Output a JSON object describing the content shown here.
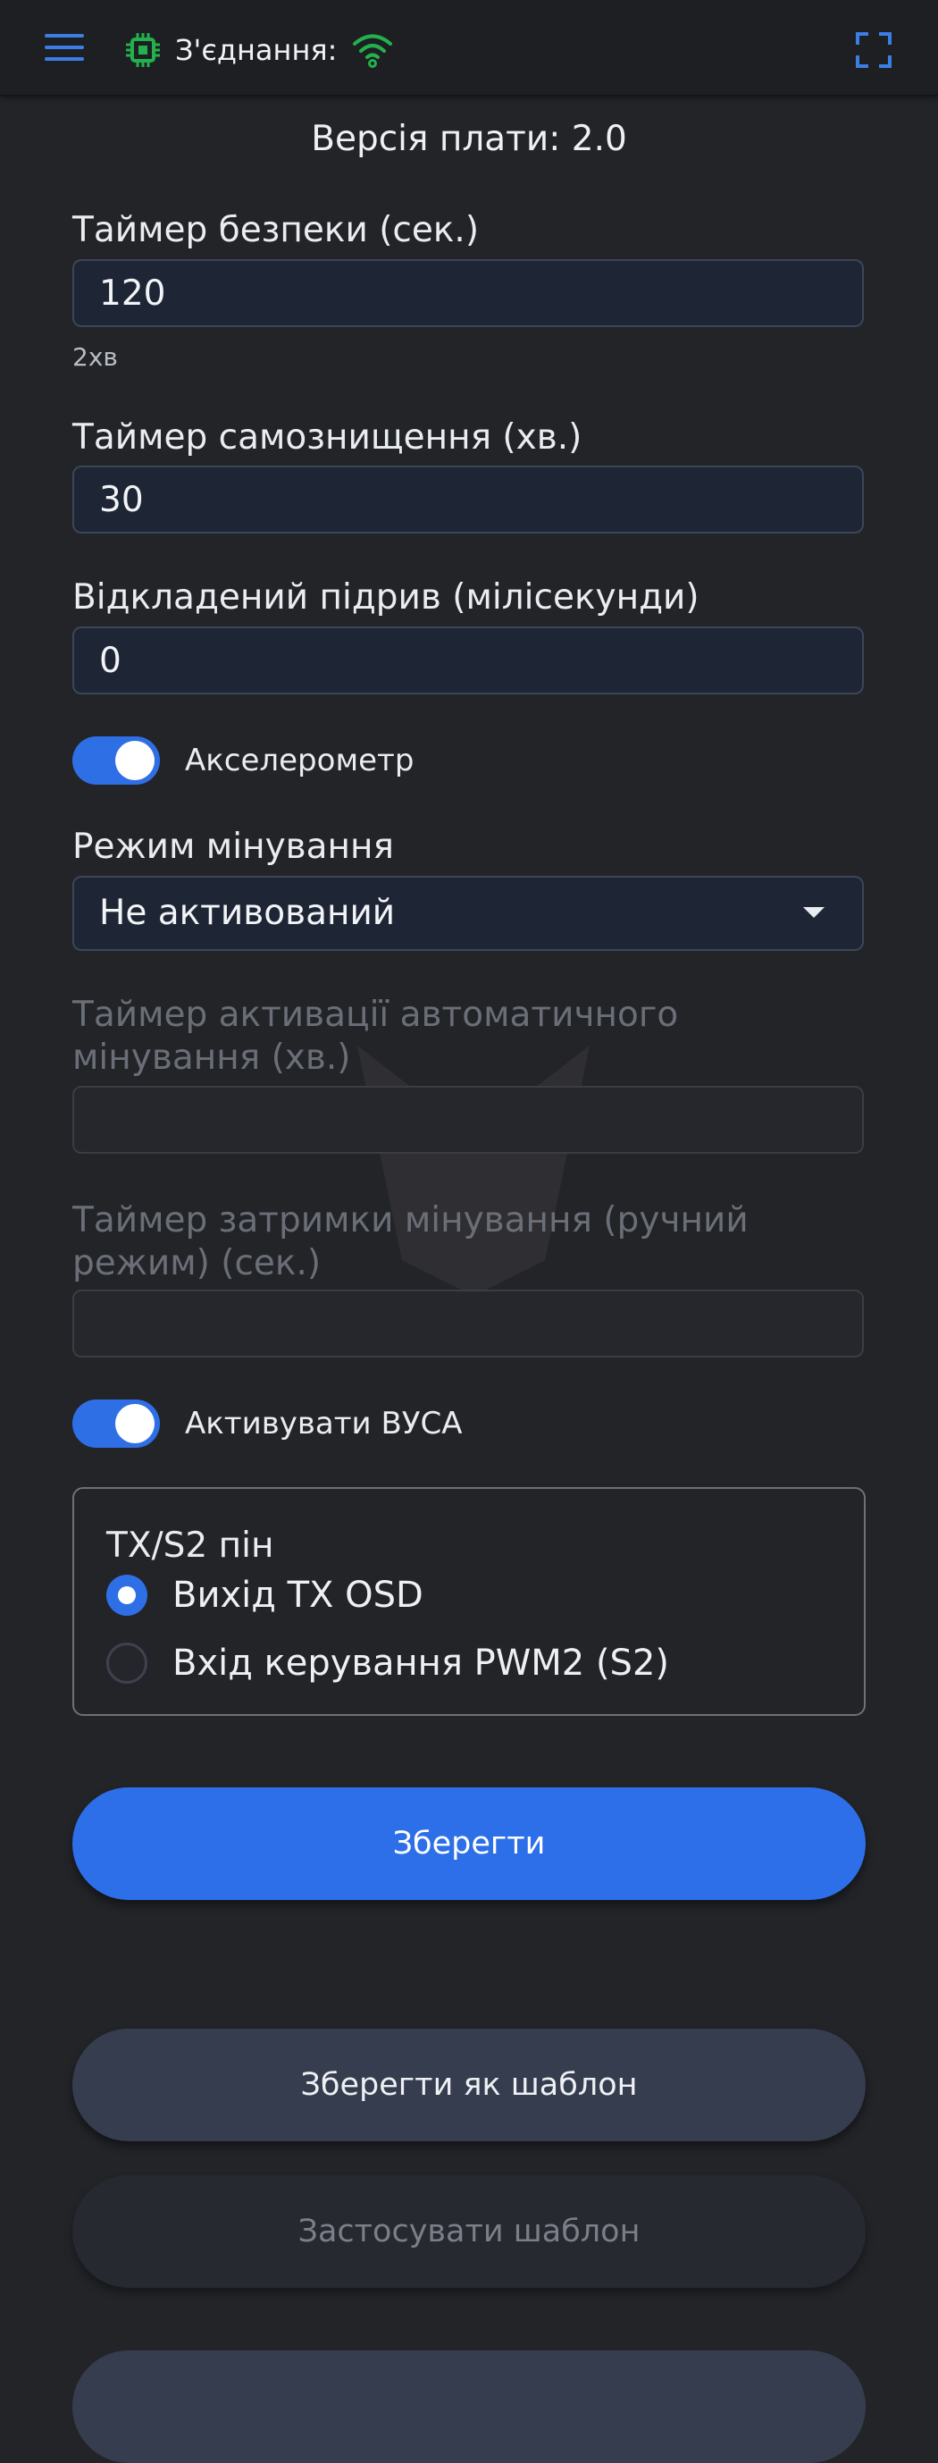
{
  "header": {
    "connection_label": "З'єднання:",
    "connection_status": "connected",
    "icons": {
      "menu": "hamburger-menu-icon",
      "chip": "chip-icon",
      "wifi": "wifi-icon",
      "fullscreen": "fullscreen-icon"
    },
    "colors": {
      "menu": "#3b7fe6",
      "chip": "#22b14c",
      "wifi": "#22b14c",
      "fullscreen": "#3b7fe6"
    }
  },
  "board_version": "Версія плати: 2.0",
  "form": {
    "safety_timer": {
      "label": "Таймер безпеки (сек.)",
      "value": "120",
      "hint": "2хв"
    },
    "self_destruct_timer": {
      "label": "Таймер самознищення (хв.)",
      "value": "30"
    },
    "delayed_detonation": {
      "label": "Відкладений підрив (мілісекунди)",
      "value": "0"
    },
    "accelerometer": {
      "label": "Акселерометр",
      "enabled": true
    },
    "mining_mode": {
      "label": "Режим мінування",
      "selected": "Не активований"
    },
    "auto_mining_activation_timer": {
      "label_line1": "Таймер активації автоматичного",
      "label_line2": "мінування (хв.)",
      "value": "",
      "disabled": true
    },
    "mining_delay_timer": {
      "label_line1": "Таймер затримки мінування (ручний",
      "label_line2": "режим) (сек.)",
      "value": "",
      "disabled": true
    },
    "activate_vusa": {
      "label": "Активувати ВУСА",
      "enabled": true
    },
    "tx_s2_pin": {
      "legend": "TX/S2 пін",
      "options": [
        {
          "label": "Вихід TX OSD",
          "selected": true
        },
        {
          "label": "Вхід керування PWM2 (S2)",
          "selected": false
        }
      ]
    }
  },
  "buttons": {
    "save": "Зберегти",
    "save_as_template": "Зберегти як шаблон",
    "apply_template": "Застосувати шаблон"
  },
  "colors": {
    "accent": "#2d6fe8",
    "background": "#232428",
    "field_background": "#1e2636"
  }
}
